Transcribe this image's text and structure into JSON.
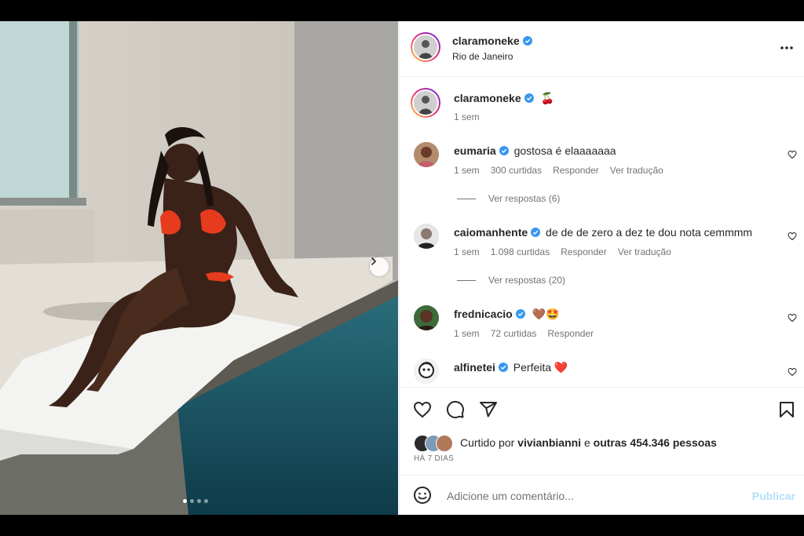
{
  "post": {
    "author": "claramoneke",
    "location": "Rio de Janeiro",
    "caption_emoji": "🍒",
    "caption_time": "1 sem"
  },
  "comments": [
    {
      "user": "eumaria",
      "text": "gostosa é elaaaaaaa",
      "time": "1 sem",
      "likes": "300 curtidas",
      "reply": "Responder",
      "translate": "Ver tradução",
      "view_replies": "Ver respostas (6)"
    },
    {
      "user": "caiomanhente",
      "text": "de de de zero a dez te dou nota cemmmm",
      "time": "1 sem",
      "likes": "1.098 curtidas",
      "reply": "Responder",
      "translate": "Ver tradução",
      "view_replies": "Ver respostas (20)"
    },
    {
      "user": "frednicacio",
      "text": "🤎🤩",
      "time": "1 sem",
      "likes": "72 curtidas",
      "reply": "Responder"
    },
    {
      "user": "alfinetei",
      "text": "Perfeita ❤️"
    }
  ],
  "likes": {
    "prefix": "Curtido por ",
    "user": "vivianbianni",
    "middle": " e ",
    "others": "outras 454.346 pessoas"
  },
  "date": "HÁ 7 DIAS",
  "add_comment": {
    "placeholder": "Adicione um comentário...",
    "publish": "Publicar"
  },
  "carousel": {
    "count": 4,
    "active": 0
  },
  "colors": {
    "verified": "#3897f0",
    "accent": "#0095f6",
    "publish_disabled": "#b2dffc",
    "muted": "#737373"
  },
  "icons": [
    "ellipsis-icon",
    "verified-badge-icon",
    "heart-icon",
    "comment-icon",
    "share-icon",
    "bookmark-icon",
    "emoji-icon",
    "chevron-right-icon"
  ]
}
